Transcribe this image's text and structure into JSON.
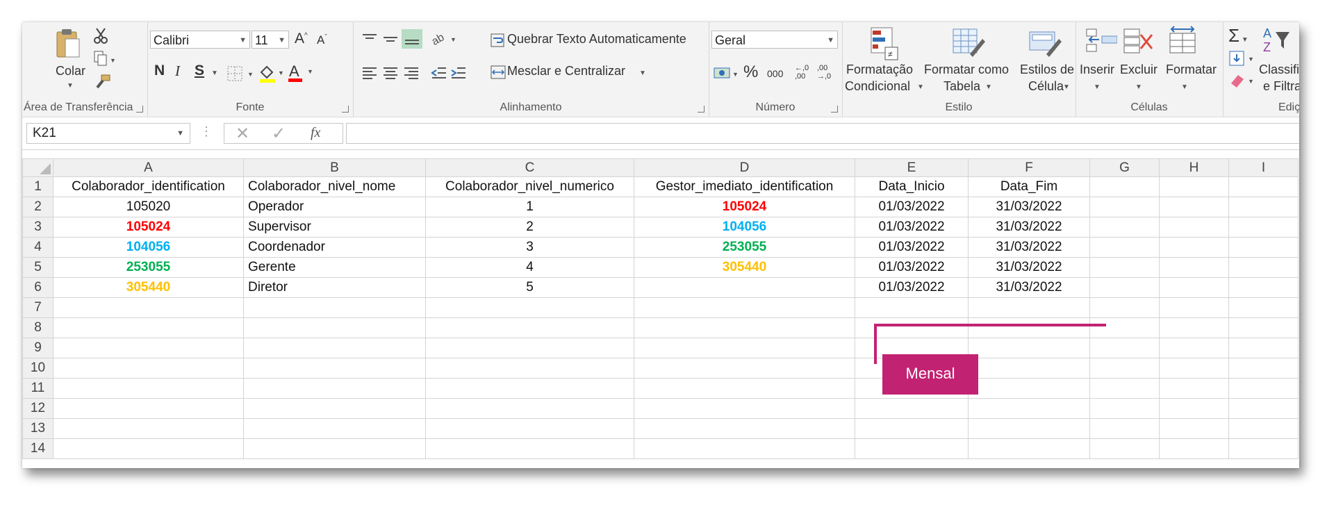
{
  "ribbon": {
    "clipboard": {
      "paste_label": "Colar",
      "group_label": "Área de Transferência"
    },
    "font": {
      "font_name": "Calibri",
      "font_size": "11",
      "bold": "N",
      "italic": "I",
      "underline": "S",
      "grow": "A",
      "shrink": "A",
      "font_color_letter": "A",
      "group_label": "Fonte"
    },
    "alignment": {
      "wrap_text": "Quebrar Texto Automaticamente",
      "merge_center": "Mesclar e Centralizar",
      "group_label": "Alinhamento"
    },
    "number": {
      "format": "Geral",
      "percent": "%",
      "thousands": "000",
      "inc_decimal": "←,0 ,00",
      "dec_decimal": ",00 →,0",
      "group_label": "Número"
    },
    "styles": {
      "conditional_1": "Formatação",
      "conditional_2": "Condicional",
      "table_1": "Formatar como",
      "table_2": "Tabela",
      "cell_1": "Estilos de",
      "cell_2": "Célula",
      "group_label": "Estilo"
    },
    "cells": {
      "insert": "Inserir",
      "delete": "Excluir",
      "format": "Formatar",
      "group_label": "Células"
    },
    "editing": {
      "sort_1": "Classificar",
      "sort_2": "e Filtrar",
      "group_label": "Ediçã"
    }
  },
  "formula_bar": {
    "name_box": "K21",
    "fx": "fx",
    "formula": ""
  },
  "sheet": {
    "columns": [
      "A",
      "B",
      "C",
      "D",
      "E",
      "F",
      "G",
      "H",
      "I"
    ],
    "rows": [
      {
        "num": "1",
        "cells": [
          "Colaborador_identification",
          "Colaborador_nivel_nome",
          "Colaborador_nivel_numerico",
          "Gestor_imediato_identification",
          "Data_Inicio",
          "Data_Fim",
          "",
          "",
          ""
        ]
      },
      {
        "num": "2",
        "cells": [
          "105020",
          "Operador",
          "1",
          "105024",
          "01/03/2022",
          "31/03/2022",
          "",
          "",
          ""
        ]
      },
      {
        "num": "3",
        "cells": [
          "105024",
          "Supervisor",
          "2",
          "104056",
          "01/03/2022",
          "31/03/2022",
          "",
          "",
          ""
        ]
      },
      {
        "num": "4",
        "cells": [
          "104056",
          "Coordenador",
          "3",
          "253055",
          "01/03/2022",
          "31/03/2022",
          "",
          "",
          ""
        ]
      },
      {
        "num": "5",
        "cells": [
          "253055",
          "Gerente",
          "4",
          "305440",
          "01/03/2022",
          "31/03/2022",
          "",
          "",
          ""
        ]
      },
      {
        "num": "6",
        "cells": [
          "305440",
          "Diretor",
          "5",
          "",
          "01/03/2022",
          "31/03/2022",
          "",
          "",
          ""
        ]
      },
      {
        "num": "7",
        "cells": [
          "",
          "",
          "",
          "",
          "",
          "",
          "",
          "",
          ""
        ]
      },
      {
        "num": "8",
        "cells": [
          "",
          "",
          "",
          "",
          "",
          "",
          "",
          "",
          ""
        ]
      },
      {
        "num": "9",
        "cells": [
          "",
          "",
          "",
          "",
          "",
          "",
          "",
          "",
          ""
        ]
      },
      {
        "num": "10",
        "cells": [
          "",
          "",
          "",
          "",
          "",
          "",
          "",
          "",
          ""
        ]
      },
      {
        "num": "11",
        "cells": [
          "",
          "",
          "",
          "",
          "",
          "",
          "",
          "",
          ""
        ]
      },
      {
        "num": "12",
        "cells": [
          "",
          "",
          "",
          "",
          "",
          "",
          "",
          "",
          ""
        ]
      },
      {
        "num": "13",
        "cells": [
          "",
          "",
          "",
          "",
          "",
          "",
          "",
          "",
          ""
        ]
      },
      {
        "num": "14",
        "cells": [
          "",
          "",
          "",
          "",
          "",
          "",
          "",
          "",
          ""
        ]
      }
    ],
    "id_colors": {
      "105024": "#ff0000",
      "104056": "#00b0f0",
      "253055": "#00b050",
      "305440": "#ffc000"
    }
  },
  "annotation": {
    "label": "Mensal",
    "color": "#c22272"
  }
}
